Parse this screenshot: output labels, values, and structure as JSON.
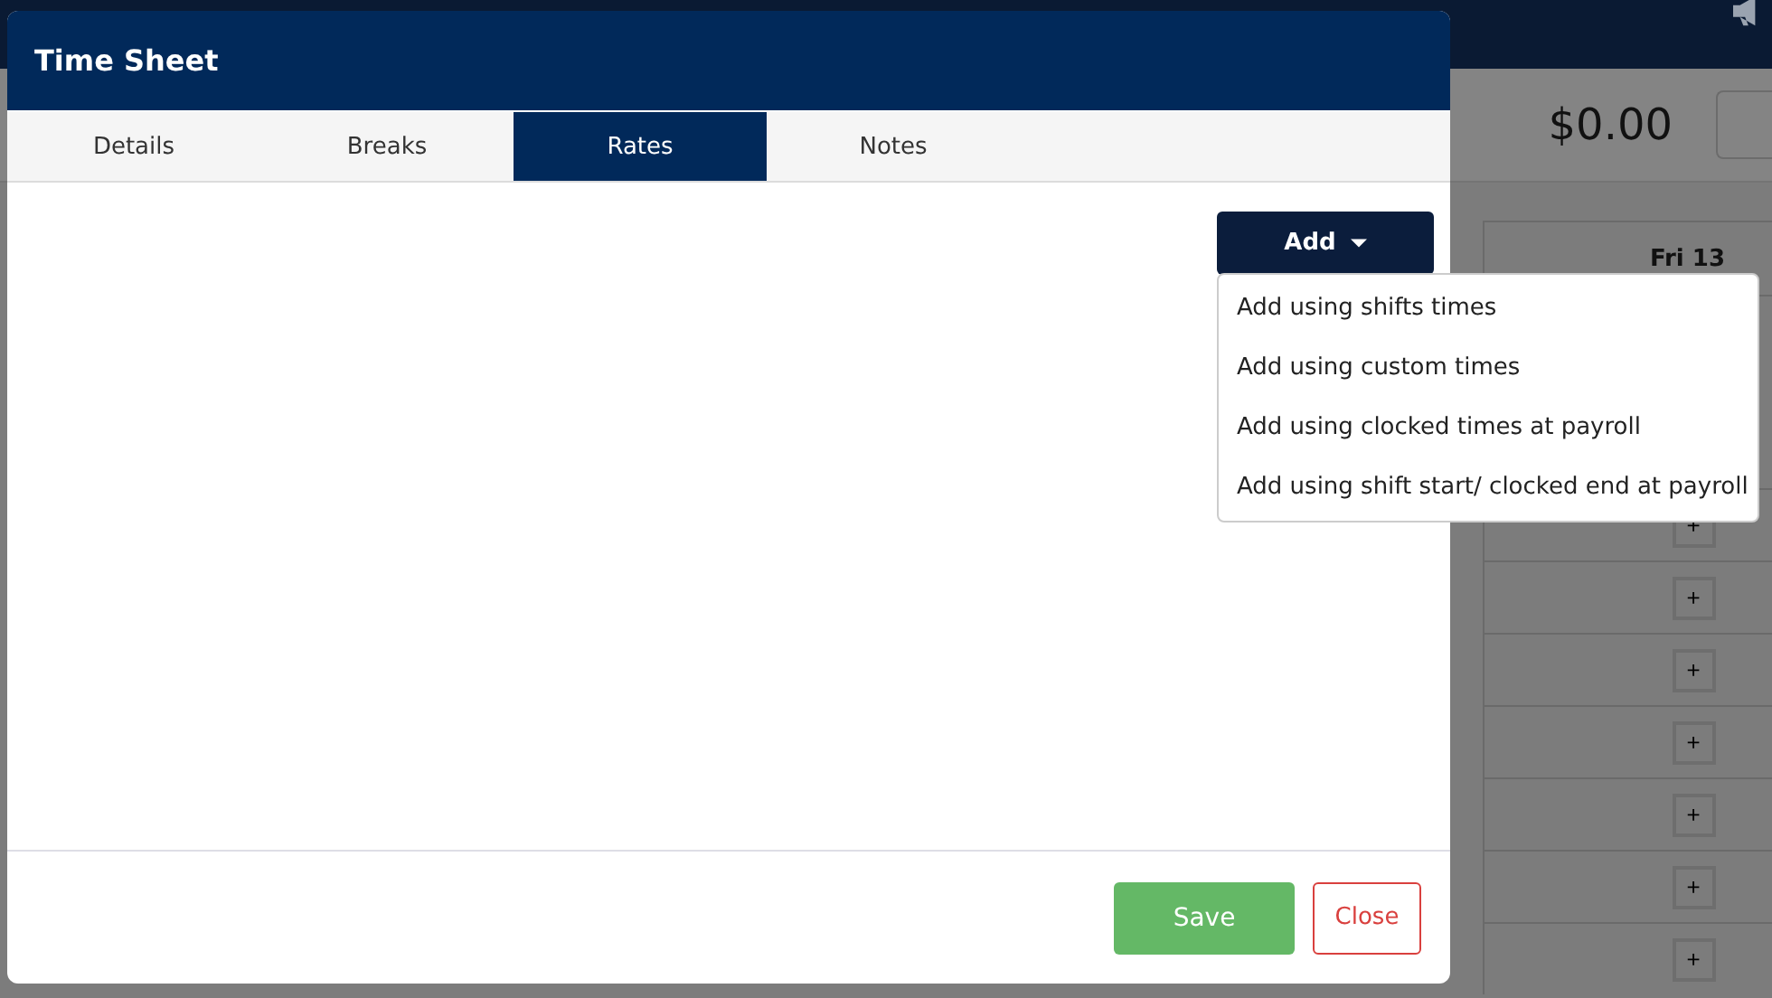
{
  "background": {
    "total": "$0.00",
    "day_column": {
      "header": "Fri 13",
      "add_buttons": [
        "+",
        "+",
        "+",
        "+",
        "+",
        "+",
        "+"
      ]
    }
  },
  "dialog": {
    "title": "Time Sheet",
    "tabs": [
      {
        "label": "Details",
        "selected": false
      },
      {
        "label": "Breaks",
        "selected": false
      },
      {
        "label": "Rates",
        "selected": true
      },
      {
        "label": "Notes",
        "selected": false
      }
    ],
    "add_button": {
      "label": "Add",
      "expanded": true
    },
    "add_menu": [
      "Add using shifts times",
      "Add using custom times",
      "Add using clocked times at payroll",
      "Add using shift start/ clocked end at payroll"
    ],
    "buttons": {
      "save": "Save",
      "close": "Close"
    }
  }
}
